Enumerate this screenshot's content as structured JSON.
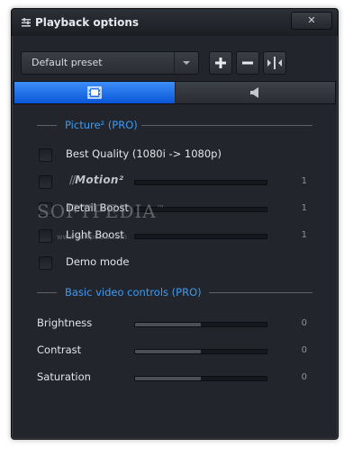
{
  "window": {
    "title": "Playback options",
    "close_label": "✕"
  },
  "preset": {
    "selected": "Default preset"
  },
  "picture_section": {
    "title": "Picture² (PRO)",
    "rows": [
      {
        "label": "Best Quality (1080i -> 1080p)"
      },
      {
        "logo": "Motion²",
        "value": "1"
      },
      {
        "label": "Detail Boost",
        "value": "1"
      },
      {
        "label": "Light Boost",
        "value": "1"
      },
      {
        "label": "Demo mode"
      }
    ]
  },
  "basic_section": {
    "title": "Basic video controls (PRO)",
    "rows": [
      {
        "label": "Brightness",
        "value": "0"
      },
      {
        "label": "Contrast",
        "value": "0"
      },
      {
        "label": "Saturation",
        "value": "0"
      }
    ]
  },
  "watermark": {
    "text": "SOFTPEDIA",
    "tm": "™",
    "sub": "www.softpedia.com"
  },
  "colors": {
    "accent": "#3b9af5",
    "active_tab": "#1565e0",
    "background": "#22262c"
  }
}
